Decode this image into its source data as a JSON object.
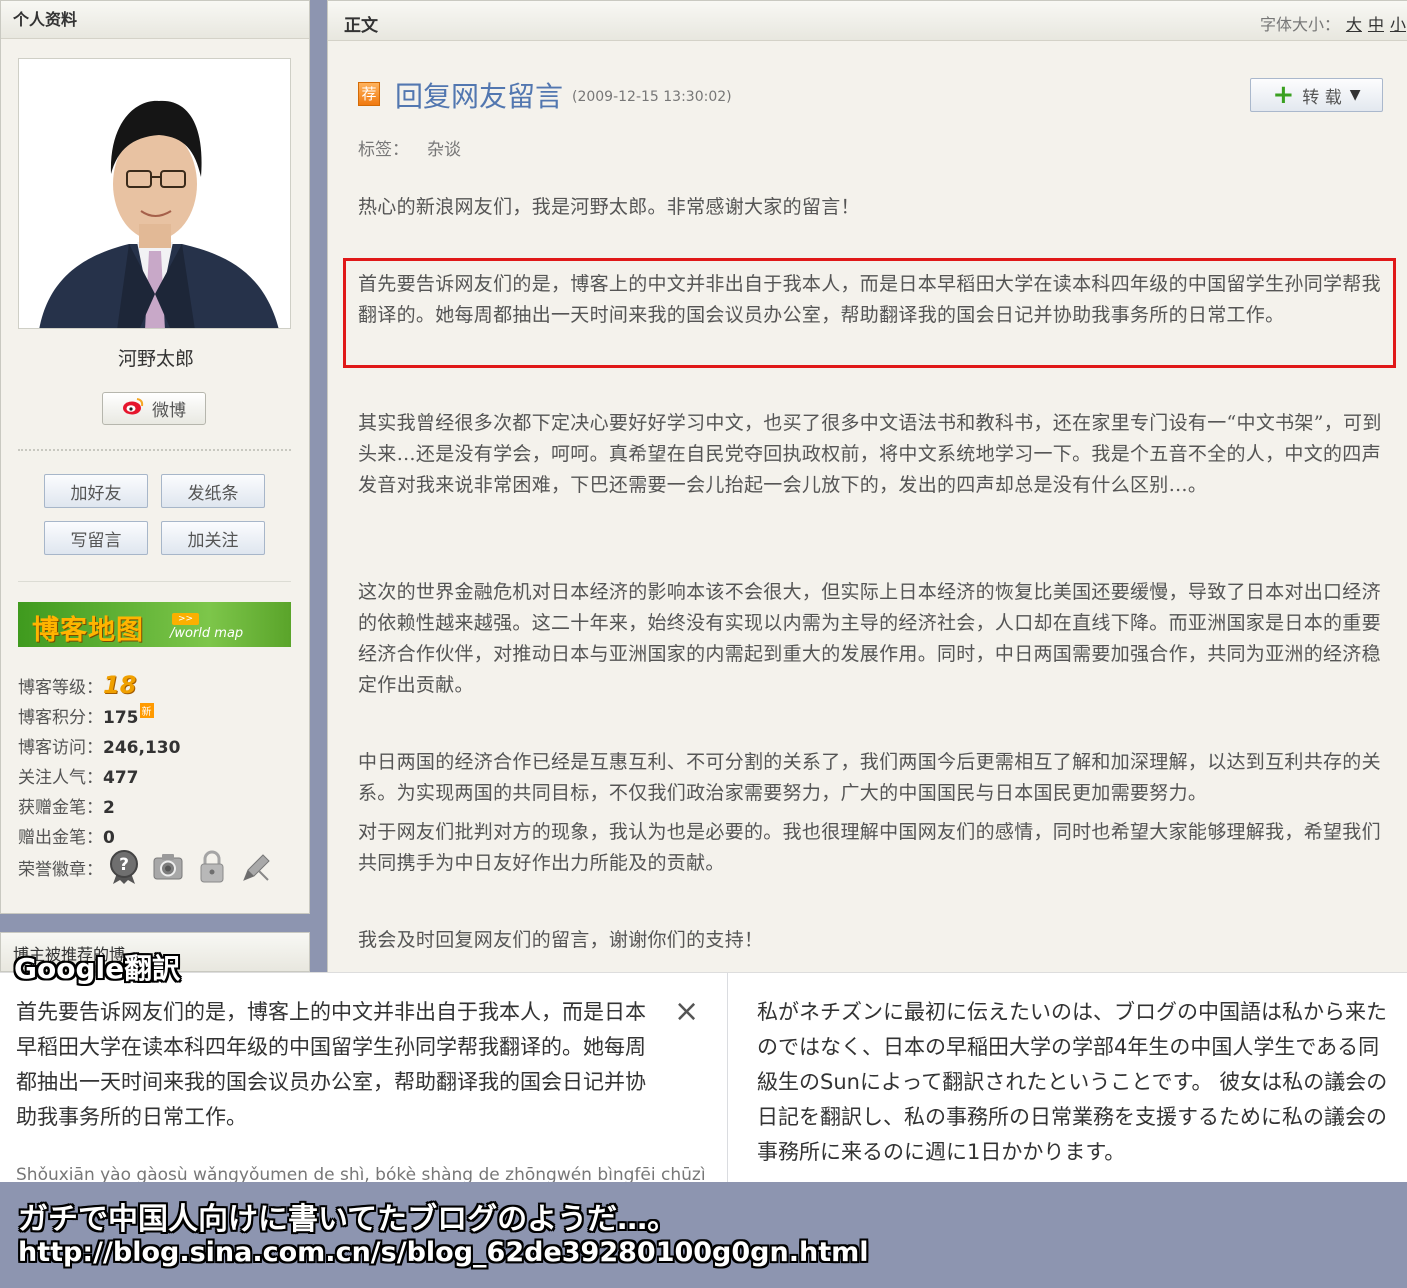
{
  "sidebar": {
    "header": "个人资料",
    "nickname": "河野太郎",
    "weibo_label": "微博",
    "buttons": {
      "add_friend": "加好友",
      "send_note": "发纸条",
      "write_message": "写留言",
      "follow": "加关注"
    },
    "map_banner": {
      "zh": "博客地图",
      "arrow": ">>",
      "en": "/world map"
    },
    "stats": [
      {
        "label": "博客等级：",
        "value": "18"
      },
      {
        "label": "博客积分：",
        "value": "175",
        "tag": "新"
      },
      {
        "label": "博客访问：",
        "value": "246,130"
      },
      {
        "label": "关注人气：",
        "value": "477"
      },
      {
        "label": "获赠金笔：",
        "value": "2"
      },
      {
        "label": "赠出金笔：",
        "value": "0"
      },
      {
        "label": "荣誉徽章：",
        "value": ""
      }
    ],
    "section2_header": "博主被推荐的博"
  },
  "article": {
    "header": "正文",
    "font_size_label": "字体大小：",
    "font_sizes": [
      "大",
      "中",
      "小"
    ],
    "rec_badge": "荐",
    "title": "回复网友留言",
    "date": "(2009-12-15 13:30:02)",
    "repost_label": "转 载",
    "tags_label": "标签：",
    "tag": "杂谈",
    "paragraphs": [
      "热心的新浪网友们，我是河野太郎。非常感谢大家的留言！",
      "首先要告诉网友们的是，博客上的中文并非出自于我本人，而是日本早稻田大学在读本科四年级的中国留学生孙同学帮我翻译的。她每周都抽出一天时间来我的国会议员办公室，帮助翻译我的国会日记并协助我事务所的日常工作。",
      "其实我曾经很多次都下定决心要好好学习中文，也买了很多中文语法书和教科书，还在家里专门设有一“中文书架”，可到头来…还是没有学会，呵呵。真希望在自民党夺回执政权前，将中文系统地学习一下。我是个五音不全的人，中文的四声发音对我来说非常困难，下巴还需要一会儿抬起一会儿放下的，发出的四声却总是没有什么区别…。",
      "这次的世界金融危机对日本经济的影响本该不会很大，但实际上日本经济的恢复比美国还要缓慢，导致了日本对出口经济的依赖性越来越强。这二十年来，始终没有实现以内需为主导的经济社会，人口却在直线下降。而亚洲国家是日本的重要经济合作伙伴，对推动日本与亚洲国家的内需起到重大的发展作用。同时，中日两国需要加强合作，共同为亚洲的经济稳定作出贡献。",
      "中日两国的经济合作已经是互惠互利、不可分割的关系了，我们两国今后更需相互了解和加深理解，以达到互利共存的关系。为实现两国的共同目标，不仅我们政治家需要努力，广大的中国国民与日本国民更加需要努力。",
      "对于网友们批判对方的现象，我认为也是必要的。我也很理解中国网友们的感情，同时也希望大家能够理解我，希望我们共同携手为中日友好作出力所能及的贡献。",
      "我会及时回复网友们的留言，谢谢你们的支持！"
    ]
  },
  "translate": {
    "label": "Google翻訳",
    "source": "首先要告诉网友们的是，博客上的中文并非出自于我本人，而是日本早稻田大学在读本科四年级的中国留学生孙同学帮我翻译的。她每周都抽出一天时间来我的国会议员办公室，帮助翻译我的国会日记并协助我事务所的日常工作。",
    "close": "×",
    "romanization": "Shǒuxiān yào gàosù wǎngyǒumen de shì, bókè shàng de zhōngwén bìngfēi chūzì",
    "result": "私がネチズンに最初に伝えたいのは、ブログの中国語は私から来たのではなく、日本の早稲田大学の学部4年生の中国人学生である同級生のSunによって翻訳されたということです。 彼女は私の議会の日記を翻訳し、私の事務所の日常業務を支援するために私の議会の事務所に来るのに週に1日かかります。"
  },
  "caption": {
    "text": "ガチで中国人向けに書いてたブログのようだ…。",
    "url": "http://blog.sina.com.cn/s/blog_62de39280100g0gn.html"
  },
  "colors": {
    "title_blue": "#5277b0",
    "highlight_red": "#e01818",
    "page_bg": "#f4f2ec",
    "caption_bg": "#8d95b0"
  }
}
